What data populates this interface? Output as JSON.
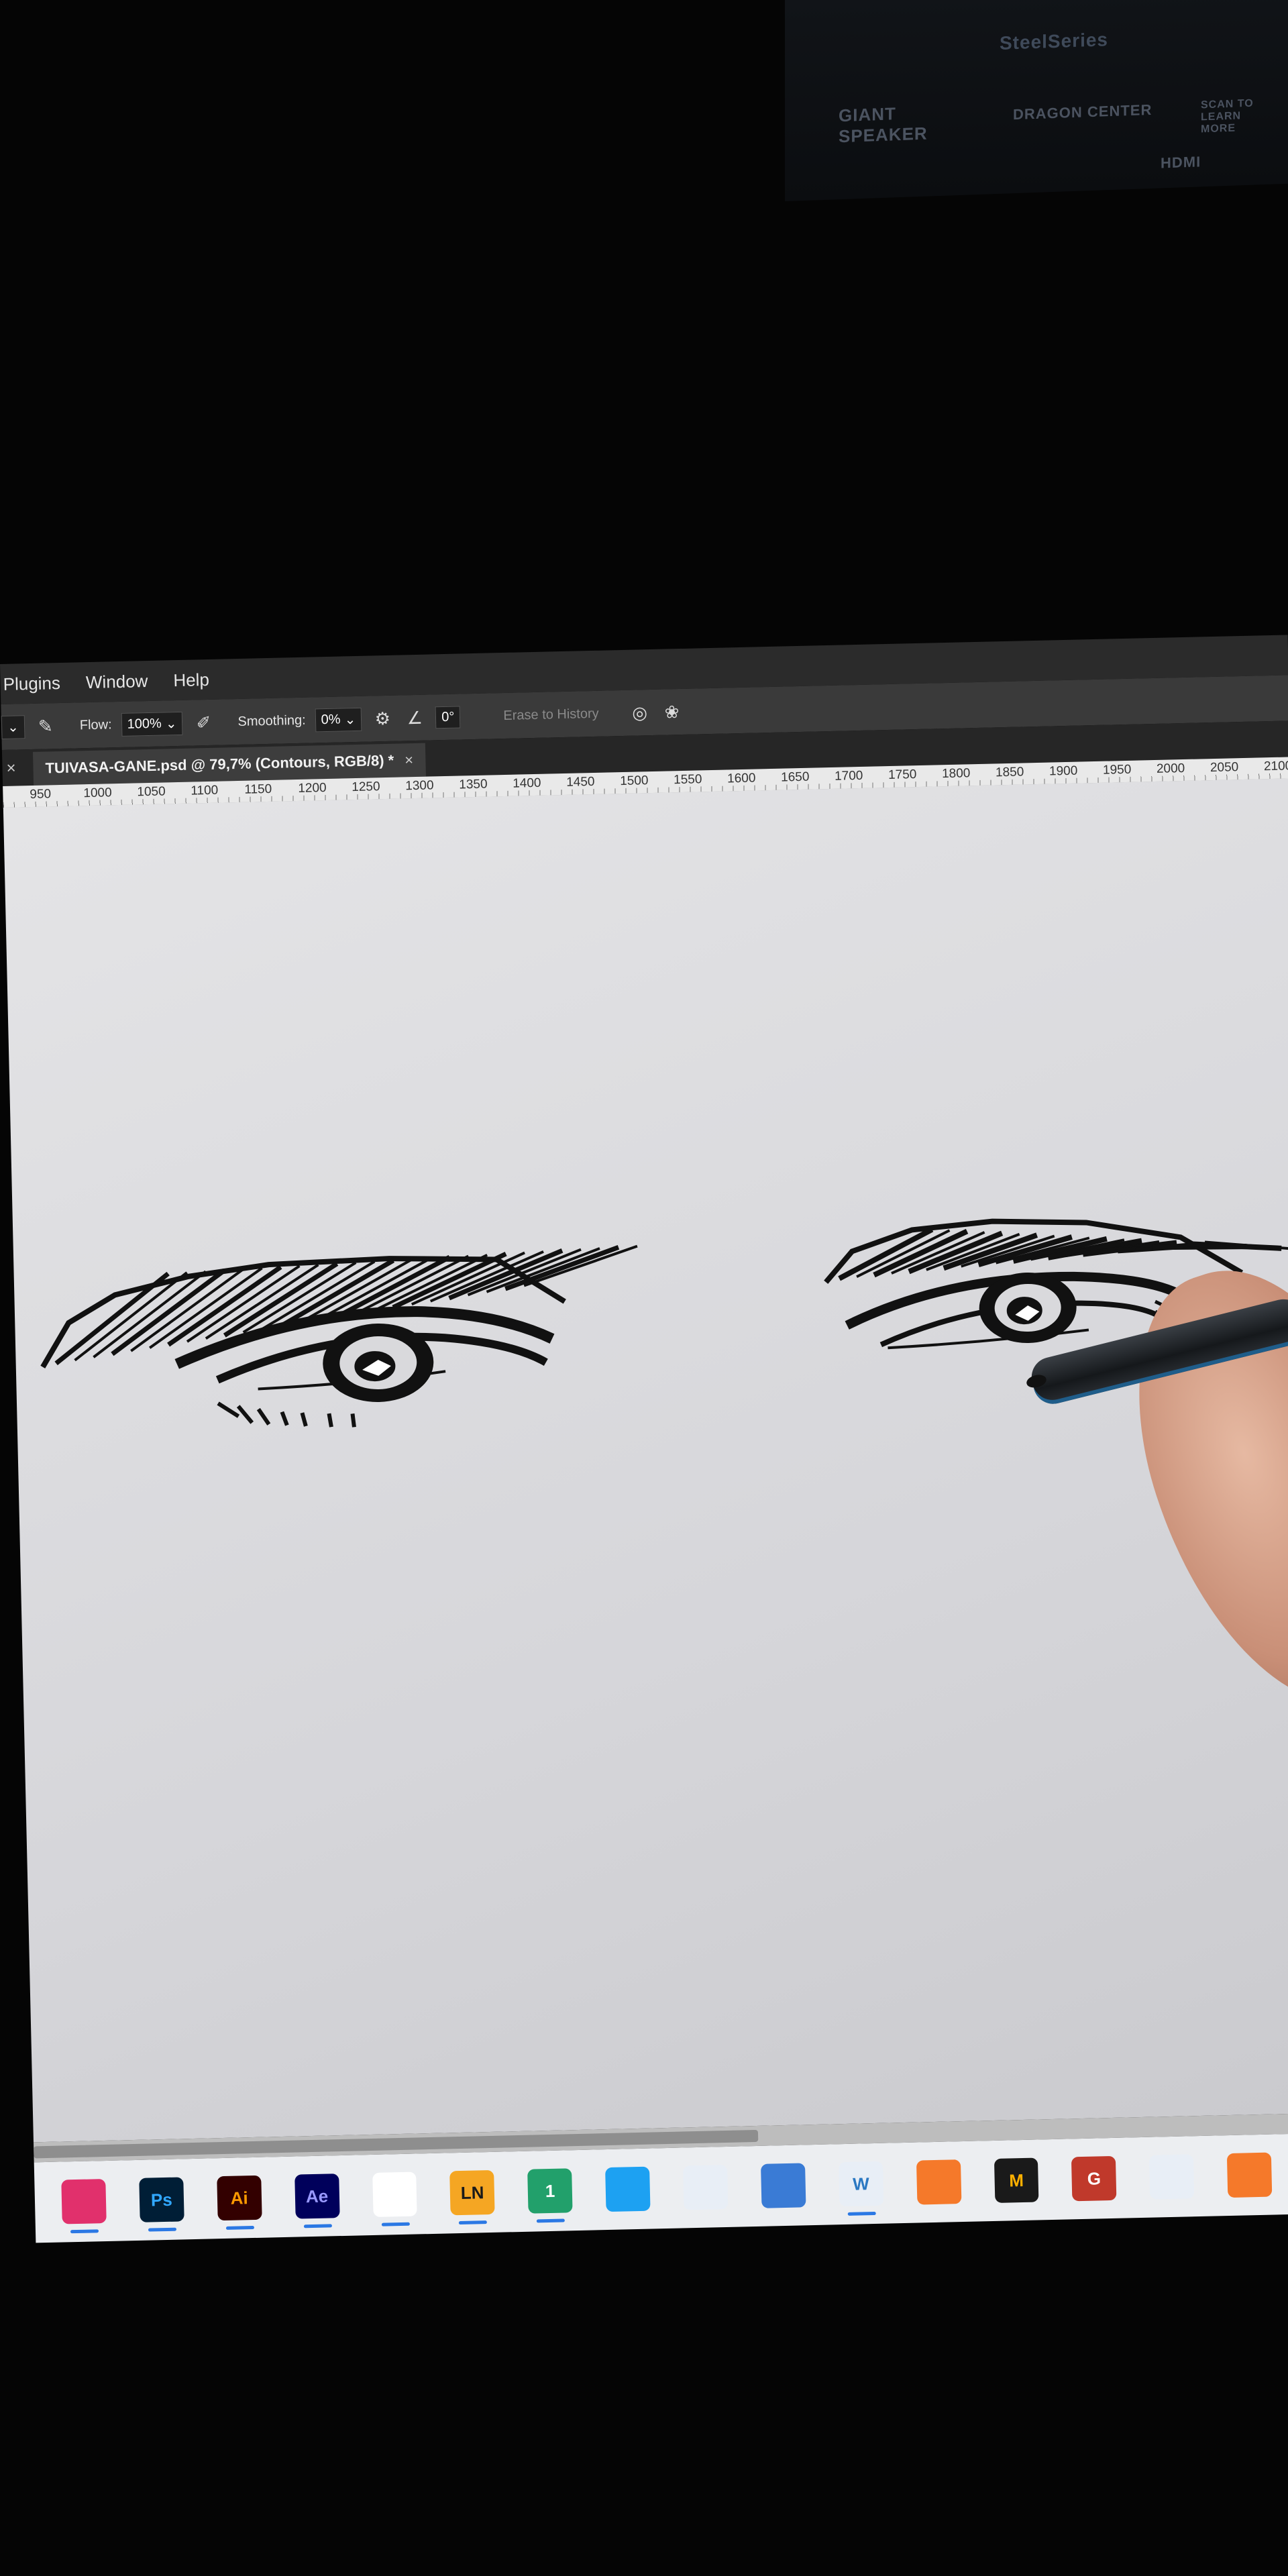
{
  "menu": {
    "items": [
      "Plugins",
      "Window",
      "Help"
    ]
  },
  "options": {
    "flow_label": "Flow:",
    "flow_value": "100%",
    "smoothing_label": "Smoothing:",
    "smoothing_value": "0%",
    "angle_value": "0°",
    "erase_to_history": "Erase to History"
  },
  "document": {
    "tab_title": "TUIVASA-GANE.psd @ 79,7% (Contours, RGB/8) *",
    "close_glyph": "×"
  },
  "ruler": {
    "ticks": [
      "950",
      "1000",
      "1050",
      "1100",
      "1150",
      "1200",
      "1250",
      "1300",
      "1350",
      "1400",
      "1450",
      "1500",
      "1550",
      "1600",
      "1650",
      "1700",
      "1750",
      "1800",
      "1850",
      "1900",
      "1950",
      "2000",
      "2050",
      "2100"
    ]
  },
  "taskbar": {
    "apps": [
      {
        "name": "Instagram",
        "label": "",
        "bg": "#e1306c"
      },
      {
        "name": "Photoshop",
        "label": "Ps",
        "bg": "#001e36",
        "fg": "#31a8ff"
      },
      {
        "name": "Illustrator",
        "label": "Ai",
        "bg": "#330000",
        "fg": "#ff9a00"
      },
      {
        "name": "After Effects",
        "label": "Ae",
        "bg": "#00005b",
        "fg": "#9999ff"
      },
      {
        "name": "Chrome",
        "label": "",
        "bg": "#ffffff"
      },
      {
        "name": "LN",
        "label": "LN",
        "bg": "#f5a623",
        "fg": "#1a1a1a"
      },
      {
        "name": "Messenger",
        "label": "1",
        "bg": "#22a06b",
        "fg": "#ffffff"
      },
      {
        "name": "Browser",
        "label": "",
        "bg": "#1da1f2"
      },
      {
        "name": "Cloud",
        "label": "",
        "bg": "#e8eef6"
      },
      {
        "name": "Calculator",
        "label": "",
        "bg": "#3a7bd5"
      },
      {
        "name": "Wacom",
        "label": "W",
        "bg": "#e8eef6",
        "fg": "#2b78c2"
      },
      {
        "name": "Blender",
        "label": "",
        "bg": "#f5792a"
      },
      {
        "name": "M",
        "label": "M",
        "bg": "#1a1a1a",
        "fg": "#ffb000"
      },
      {
        "name": "G",
        "label": "G",
        "bg": "#c0392b",
        "fg": "#ffffff"
      },
      {
        "name": "Tools",
        "label": "",
        "bg": "#e8eef6"
      },
      {
        "name": "Blender 2",
        "label": "",
        "bg": "#f5792a"
      },
      {
        "name": "App",
        "label": "",
        "bg": "#e74c3c"
      }
    ]
  },
  "backdrop": {
    "lines": [
      "SteelSeries",
      "GIANT SPEAKER",
      "DRAGON CENTER",
      "SCAN TO LEARN MORE",
      "HDMI"
    ]
  }
}
